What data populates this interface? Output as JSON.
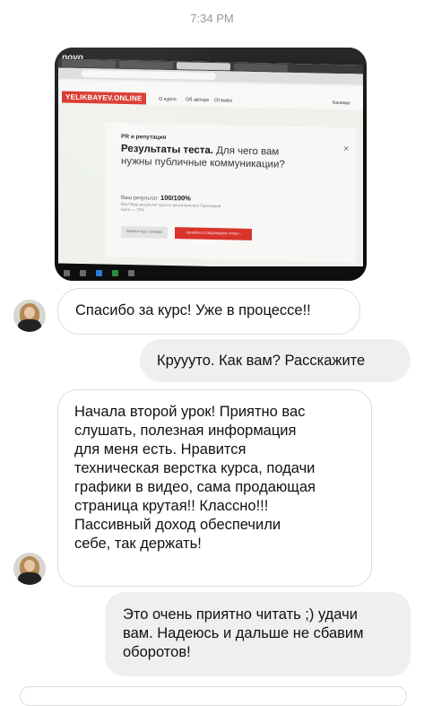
{
  "timestamp": "7:34 PM",
  "photo": {
    "brand": "novo",
    "site_logo": "YELIKBAYEV.ONLINE",
    "nav": [
      "О курсе",
      "Об авторе",
      "Отзывы",
      "Казнаш"
    ],
    "kicker": "PR и репутация",
    "title_bold": "Результаты теста.",
    "title_rest": "Для чего вам нужны публичные коммуникации?",
    "score_label": "Ваш результат:",
    "score_value": "100/100%",
    "score_sub": "Вау! Ваш результат просто восхитителен! Проходной балл — 70%",
    "btn_retry": "ПРОЙТИ ТЕСТ ЗАНОВО",
    "btn_next": "ПЕРЕЙТИ К СЛЕДУЮЩЕМУ УРОКУ ›"
  },
  "messages": [
    {
      "direction": "in",
      "lines": [
        "Спасибо за курс! Уже в процессе!!"
      ]
    },
    {
      "direction": "out",
      "lines": [
        "Круууто. Как вам? Расскажите"
      ]
    },
    {
      "direction": "in",
      "lines": [
        "Начала второй урок! Приятно вас",
        "слушать, полезная информация",
        "для меня есть. Нравится",
        "техническая верстка курса, подачи",
        "графики в видео, сама продающая",
        "страница крутая!! Классно!!!",
        "Пассивный доход обеспечили",
        "себе, так держать!"
      ]
    },
    {
      "direction": "out",
      "lines": [
        "Это очень приятно читать ;) удачи",
        "вам. Надеюсь и дальше не сбавим",
        "оборотов!"
      ]
    }
  ]
}
